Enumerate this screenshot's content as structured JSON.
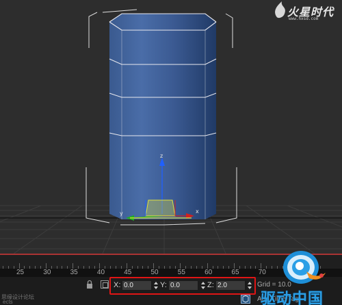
{
  "watermark": {
    "logo_text": "火星时代",
    "url": "www.hxsd.com"
  },
  "timeline": {
    "ticks": [
      "25",
      "30",
      "35",
      "40",
      "45",
      "50",
      "55",
      "60",
      "65",
      "70"
    ]
  },
  "axis_labels": {
    "x": "x",
    "y": "y",
    "z": "z"
  },
  "coordinates": {
    "x_label": "X:",
    "x_value": "0.0",
    "y_label": "Y:",
    "y_value": "0.0",
    "z_label": "Z:",
    "z_value": "2.0"
  },
  "status": {
    "grid": "Grid = 10.0",
    "add_time_tag": "Add Time Tag",
    "left_line1": "思缘设计论坛",
    "left_line2": "ects"
  },
  "brand": {
    "site_name": "驱动中国"
  },
  "colors": {
    "cylinder": "#3f5f96",
    "highlight_box": "#e01515",
    "x_axis": "#d02020",
    "y_axis": "#20b020",
    "z_axis": "#2060ff",
    "brand_blue": "#2b9fe6",
    "brand_orange": "#f09020"
  },
  "icons": [
    "lock-icon",
    "absolute-mode-icon",
    "spinner-up-down-icon",
    "add-time-tag-icon",
    "q-brand-logo"
  ]
}
